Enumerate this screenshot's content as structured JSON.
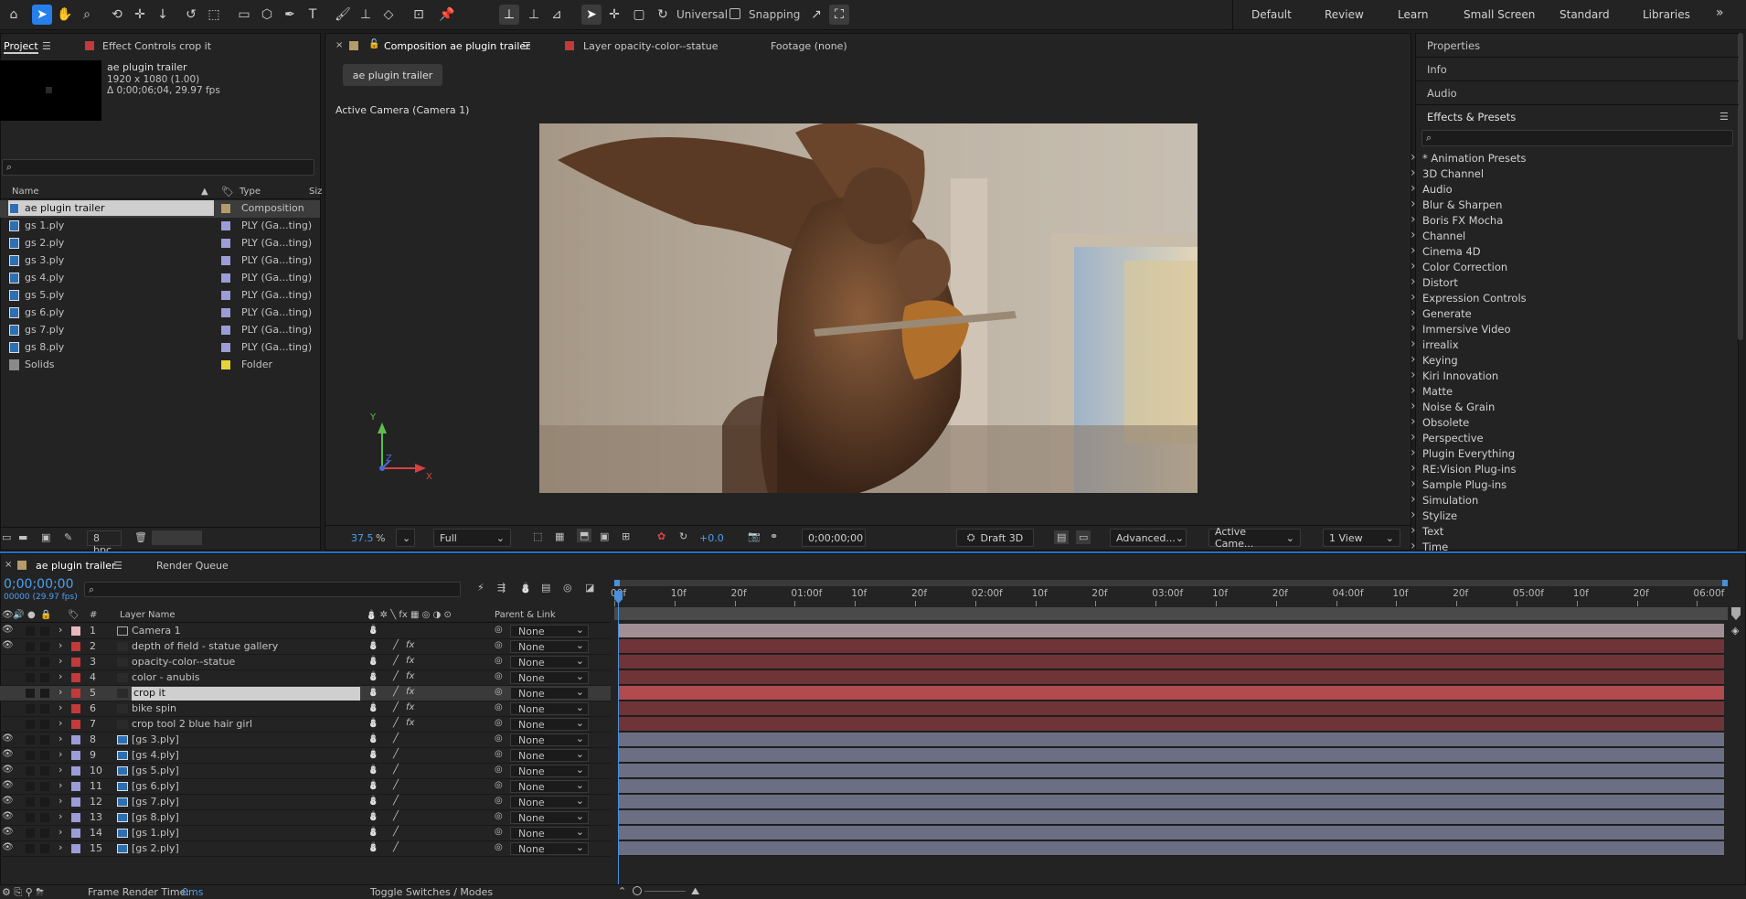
{
  "toolbar": {
    "universal_label": "Universal",
    "snapping_label": "Snapping",
    "workspaces": [
      "Default",
      "Review",
      "Learn",
      "Small Screen",
      "Standard",
      "Libraries"
    ]
  },
  "project_panel": {
    "tab_project": "Project",
    "tab_effect_controls": "Effect Controls crop it",
    "comp_name": "ae plugin trailer",
    "comp_info_dims": "1920 x 1080 (1.00)",
    "comp_info_dur": "Δ 0;00;06;04, 29.97 fps",
    "search_placeholder": "",
    "col_name": "Name",
    "col_type": "Type",
    "col_size": "Siz",
    "items": [
      {
        "name": "ae plugin trailer",
        "type": "Composition",
        "color": "#b59a6a",
        "selected": true
      },
      {
        "name": "gs 1.ply",
        "type": "PLY (Ga...ting)",
        "color": "#9c9cd8"
      },
      {
        "name": "gs 2.ply",
        "type": "PLY (Ga...ting)",
        "color": "#9c9cd8"
      },
      {
        "name": "gs 3.ply",
        "type": "PLY (Ga...ting)",
        "color": "#9c9cd8"
      },
      {
        "name": "gs 4.ply",
        "type": "PLY (Ga...ting)",
        "color": "#9c9cd8"
      },
      {
        "name": "gs 5.ply",
        "type": "PLY (Ga...ting)",
        "color": "#9c9cd8"
      },
      {
        "name": "gs 6.ply",
        "type": "PLY (Ga...ting)",
        "color": "#9c9cd8"
      },
      {
        "name": "gs 7.ply",
        "type": "PLY (Ga...ting)",
        "color": "#9c9cd8"
      },
      {
        "name": "gs 8.ply",
        "type": "PLY (Ga...ting)",
        "color": "#9c9cd8"
      },
      {
        "name": "Solids",
        "type": "Folder",
        "color": "#e6d33a"
      }
    ],
    "bpc": "8 bpc"
  },
  "comp_panel": {
    "tab_composition": "Composition ae plugin trailer",
    "tab_layer": "Layer opacity-color--statue",
    "tab_footage": "Footage (none)",
    "breadcrumb": "ae plugin trailer",
    "camera_label": "Active Camera (Camera 1)",
    "zoom": "37.5",
    "zoom_unit": "%",
    "resolution": "Full",
    "exposure": "+0.0",
    "timecode": "0;00;00;00",
    "renderer": "Draft 3D",
    "advanced": "Advanced...",
    "view_camera": "Active Came...",
    "view_count": "1 View",
    "axis_x": "X",
    "axis_y": "Y",
    "axis_z": "Z"
  },
  "right_panel": {
    "properties": "Properties",
    "info": "Info",
    "audio": "Audio",
    "effects_presets": "Effects & Presets",
    "effects": [
      "* Animation Presets",
      "3D Channel",
      "Audio",
      "Blur & Sharpen",
      "Boris FX Mocha",
      "Channel",
      "Cinema 4D",
      "Color Correction",
      "Distort",
      "Expression Controls",
      "Generate",
      "Immersive Video",
      "irrealix",
      "Keying",
      "Kiri Innovation",
      "Matte",
      "Noise & Grain",
      "Obsolete",
      "Perspective",
      "Plugin Everything",
      "RE:Vision Plug-ins",
      "Sample Plug-ins",
      "Simulation",
      "Stylize",
      "Text",
      "Time"
    ]
  },
  "timeline": {
    "tab_comp": "ae plugin trailer",
    "tab_render_queue": "Render Queue",
    "timecode": "0;00;00;00",
    "fps": "00000 (29.97 fps)",
    "col_number": "#",
    "col_layer_name": "Layer Name",
    "col_parent": "Parent & Link",
    "ruler": [
      "00f",
      "10f",
      "20f",
      "01:00f",
      "10f",
      "20f",
      "02:00f",
      "10f",
      "20f",
      "03:00f",
      "10f",
      "20f",
      "04:00f",
      "10f",
      "20f",
      "05:00f",
      "10f",
      "20f",
      "06:00f"
    ],
    "layers": [
      {
        "num": "1",
        "name": "Camera 1",
        "color": "#e8b8bf",
        "kind": "camera",
        "parent": "None",
        "visible": true,
        "bar": "#a28f96"
      },
      {
        "num": "2",
        "name": "depth of field - statue gallery",
        "color": "#c23a3a",
        "kind": "adj",
        "parent": "None",
        "visible": true,
        "bar": "#6f3437"
      },
      {
        "num": "3",
        "name": "opacity-color--statue",
        "color": "#c23a3a",
        "kind": "adj",
        "parent": "None",
        "visible": false,
        "bar": "#6f3437"
      },
      {
        "num": "4",
        "name": "color - anubis",
        "color": "#c23a3a",
        "kind": "adj",
        "parent": "None",
        "visible": false,
        "bar": "#6f3437"
      },
      {
        "num": "5",
        "name": "crop it",
        "color": "#c23a3a",
        "kind": "adj",
        "parent": "None",
        "visible": false,
        "selected": true,
        "bar": "#b24b4f"
      },
      {
        "num": "6",
        "name": "bike spin",
        "color": "#c23a3a",
        "kind": "adj",
        "parent": "None",
        "visible": false,
        "bar": "#6f3437"
      },
      {
        "num": "7",
        "name": "crop tool 2 blue hair girl",
        "color": "#c23a3a",
        "kind": "adj",
        "parent": "None",
        "visible": false,
        "bar": "#6f3437"
      },
      {
        "num": "8",
        "name": "[gs 3.ply]",
        "color": "#9c9cd8",
        "kind": "ply",
        "parent": "None",
        "visible": true,
        "bar": "#6c6e84"
      },
      {
        "num": "9",
        "name": "[gs 4.ply]",
        "color": "#9c9cd8",
        "kind": "ply",
        "parent": "None",
        "visible": true,
        "bar": "#6c6e84"
      },
      {
        "num": "10",
        "name": "[gs 5.ply]",
        "color": "#9c9cd8",
        "kind": "ply",
        "parent": "None",
        "visible": true,
        "bar": "#6c6e84"
      },
      {
        "num": "11",
        "name": "[gs 6.ply]",
        "color": "#9c9cd8",
        "kind": "ply",
        "parent": "None",
        "visible": true,
        "bar": "#6c6e84"
      },
      {
        "num": "12",
        "name": "[gs 7.ply]",
        "color": "#9c9cd8",
        "kind": "ply",
        "parent": "None",
        "visible": true,
        "bar": "#6c6e84"
      },
      {
        "num": "13",
        "name": "[gs 8.ply]",
        "color": "#9c9cd8",
        "kind": "ply",
        "parent": "None",
        "visible": true,
        "bar": "#6c6e84"
      },
      {
        "num": "14",
        "name": "[gs 1.ply]",
        "color": "#9c9cd8",
        "kind": "ply",
        "parent": "None",
        "visible": true,
        "bar": "#6c6e84"
      },
      {
        "num": "15",
        "name": "[gs 2.ply]",
        "color": "#9c9cd8",
        "kind": "ply",
        "parent": "None",
        "visible": true,
        "bar": "#6c6e84"
      }
    ],
    "render_time_label": "Frame Render Time:",
    "render_time_value": "0ms",
    "toggle_label": "Toggle Switches / Modes"
  },
  "colors": {
    "accent": "#2680eb",
    "panel": "#232323"
  }
}
